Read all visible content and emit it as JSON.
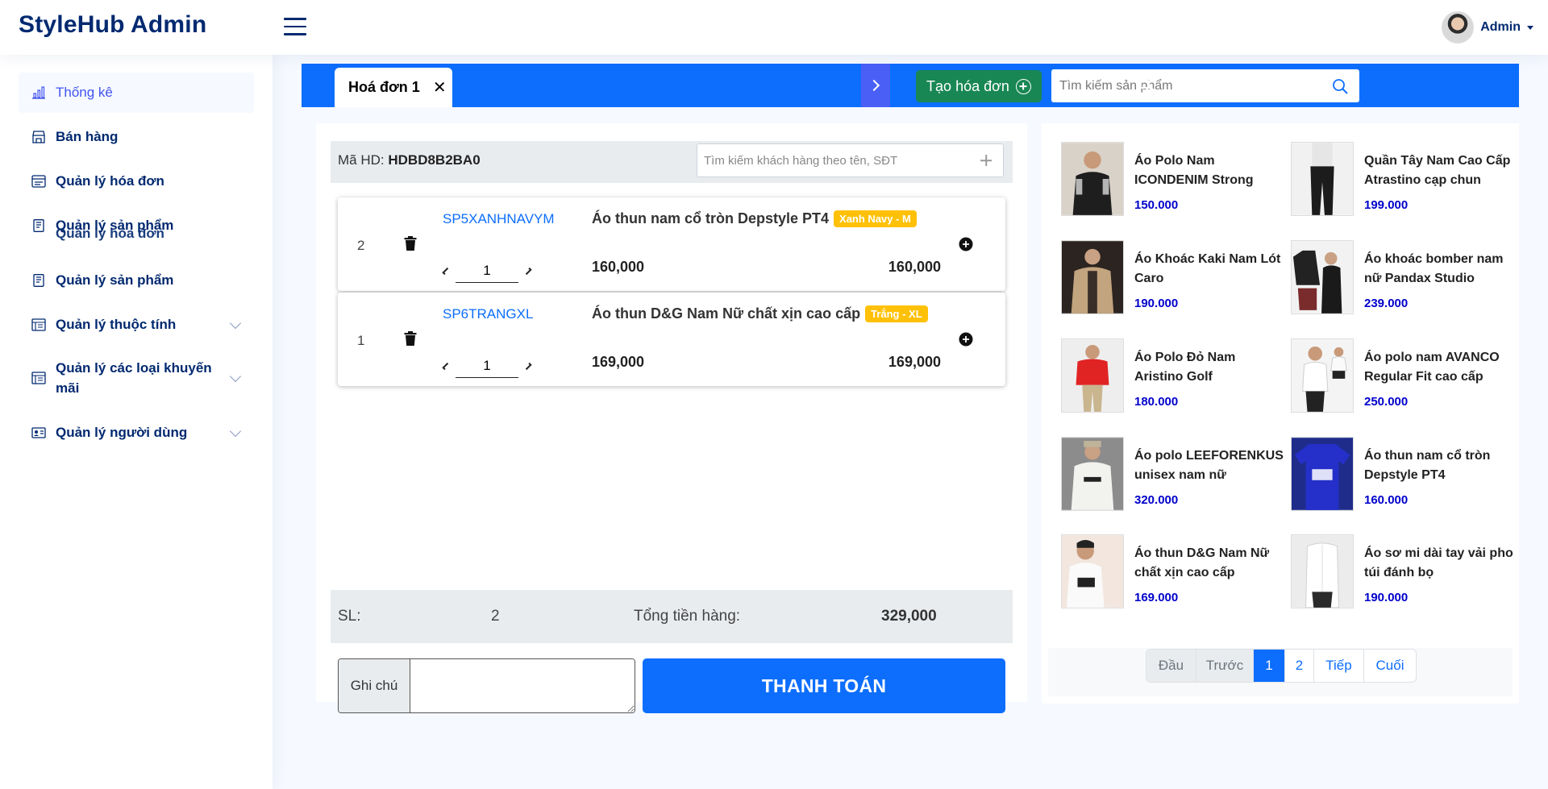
{
  "header": {
    "brand": "StyleHub Admin",
    "user_name": "Admin"
  },
  "sidebar": {
    "items": [
      {
        "label": "Thống kê",
        "icon": "bar-chart-icon"
      },
      {
        "label": "Bán hàng",
        "icon": "shop-icon"
      },
      {
        "label": "Quản lý hóa đơn",
        "icon": "receipt-icon"
      },
      {
        "label": "Quản lý sản phẩm",
        "icon": "journal-icon"
      },
      {
        "label": "Quản lý sản phẩm",
        "icon": "journal-icon"
      },
      {
        "label": "Quản lý thuộc tính",
        "icon": "layout-icon"
      },
      {
        "label": "Quản lý các loại khuyến mãi",
        "icon": "layout-icon"
      },
      {
        "label": "Quản lý người dùng",
        "icon": "person-card-icon"
      }
    ],
    "ghost_label": "Quản lý hóa đơn"
  },
  "tabs": {
    "active_label": "Hoá đơn 1",
    "close_glyph": "✕",
    "create_label": "Tạo hóa đơn",
    "search_placeholder": "Tìm kiếm sản phẩm"
  },
  "invoice": {
    "code_label": "Mã HD:",
    "code_value": "HDBD8B2BA0",
    "customer_placeholder": "Tìm kiếm khách hàng theo tên, SĐT",
    "lines": [
      {
        "index": "2",
        "sku": "SP5XANHNAVYM",
        "name": "Áo thun nam cổ tròn Depstyle PT4",
        "variant": "Xanh Navy - M",
        "qty": "1",
        "price": "160,000",
        "total": "160,000"
      },
      {
        "index": "1",
        "sku": "SP6TRANGXL",
        "name": "Áo thun D&G Nam Nữ chất xịn cao cấp",
        "variant": "Trắng - XL",
        "qty": "1",
        "price": "169,000",
        "total": "169,000"
      }
    ],
    "summary": {
      "qty_label": "SL:",
      "qty_value": "2",
      "total_label": "Tổng tiền hàng:",
      "total_value": "329,000"
    },
    "note_label": "Ghi chú",
    "pay_label": "THANH TOÁN"
  },
  "products": [
    {
      "name": "Áo Polo Nam ICONDENIM Strong",
      "price": "150.000"
    },
    {
      "name": "Quần Tây Nam Cao Cấp Atrastino cạp chun",
      "price": "199.000"
    },
    {
      "name": "Áo Khoác Kaki Nam Lót Caro",
      "price": "190.000"
    },
    {
      "name": "Áo khoác bomber nam nữ Pandax Studio",
      "price": "239.000"
    },
    {
      "name": "Áo Polo Đỏ Nam Aristino Golf",
      "price": "180.000"
    },
    {
      "name": "Áo polo nam AVANCO Regular Fit cao cấp",
      "price": "250.000"
    },
    {
      "name": "Áo polo LEEFORENKUS unisex nam nữ",
      "price": "320.000"
    },
    {
      "name": "Áo thun nam cổ tròn Depstyle PT4",
      "price": "160.000"
    },
    {
      "name": "Áo thun D&G Nam Nữ chất xịn cao cấp",
      "price": "169.000"
    },
    {
      "name": "Áo sơ mi dài tay vải pho túi đánh bọ",
      "price": "190.000"
    }
  ],
  "pagination": {
    "first": "Đầu",
    "prev": "Trước",
    "page1": "1",
    "page2": "2",
    "next": "Tiếp",
    "last": "Cuối"
  },
  "colors": {
    "brand": "#012970",
    "primary": "#0d6efd",
    "success": "#198754",
    "badge": "#ffc107",
    "price": "#0000cc"
  }
}
